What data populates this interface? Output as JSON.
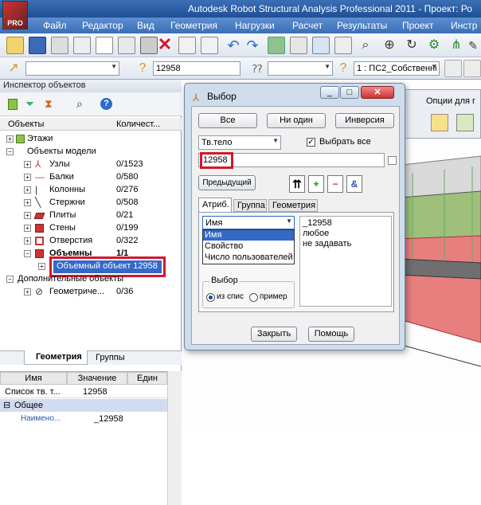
{
  "app": {
    "title": "Autodesk Robot Structural Analysis Professional 2011 - Проект: Ро",
    "logo_label": "PRO"
  },
  "menu": [
    "Файл",
    "Редактор",
    "Вид",
    "Геометрия",
    "Нагрузки",
    "Расчет",
    "Результаты",
    "Проект",
    "Инстр"
  ],
  "toolbar2": {
    "selection_value": "12958",
    "load_case": "1 : ПС2_Собственні"
  },
  "inspector": {
    "title": "Инспектор объектов",
    "col_objects": "Объекты",
    "col_count": "Количест...",
    "tree": {
      "floors": "Этажи",
      "model_objects": "Объекты модели",
      "nodes": {
        "label": "Узлы",
        "count": "0/1523"
      },
      "beams": {
        "label": "Балки",
        "count": "0/580"
      },
      "columns": {
        "label": "Колонны",
        "count": "0/276"
      },
      "bars": {
        "label": "Стержни",
        "count": "0/508"
      },
      "slabs": {
        "label": "Плиты",
        "count": "0/21"
      },
      "walls": {
        "label": "Стены",
        "count": "0/199"
      },
      "openings": {
        "label": "Отверстия",
        "count": "0/322"
      },
      "volumes": {
        "label": "Объемны",
        "count": "1/1"
      },
      "volume_object": "Объемный объект  12958",
      "additional": "Дополнительные объекты",
      "geometric": {
        "label": "Геометриче...",
        "count": "0/36"
      }
    },
    "tabs": [
      "Геометрия",
      "Группы"
    ]
  },
  "properties": {
    "headers": [
      "Имя",
      "Значение",
      "Един"
    ],
    "rows": [
      {
        "name": "Список тв. т...",
        "value": "12958"
      }
    ],
    "section": "Общее",
    "sub_name": "Наимено...",
    "sub_value": "_12958"
  },
  "dialog": {
    "title": "Выбор",
    "all_button": "Все",
    "none_button": "Ни один",
    "invert_button": "Инверсия",
    "type_combo": "Тв.тело",
    "select_all_label": "Выбрать все",
    "select_all_checked": true,
    "selection_field": "12958",
    "previous_button": "Предыдущий",
    "tabs": [
      "Атриб.",
      "Группа",
      "Геометрия"
    ],
    "attr_combo": "Имя",
    "attr_options": [
      "Имя",
      "Свойство",
      "Число пользователей"
    ],
    "values_list": [
      "_12958",
      "любое",
      "не задавать"
    ],
    "choice_group": "Выбор",
    "radio_list": "из спис",
    "radio_example": "пример",
    "close_button": "Закрыть",
    "help_button": "Помощь"
  },
  "options_panel": {
    "title": "Опции для г"
  }
}
